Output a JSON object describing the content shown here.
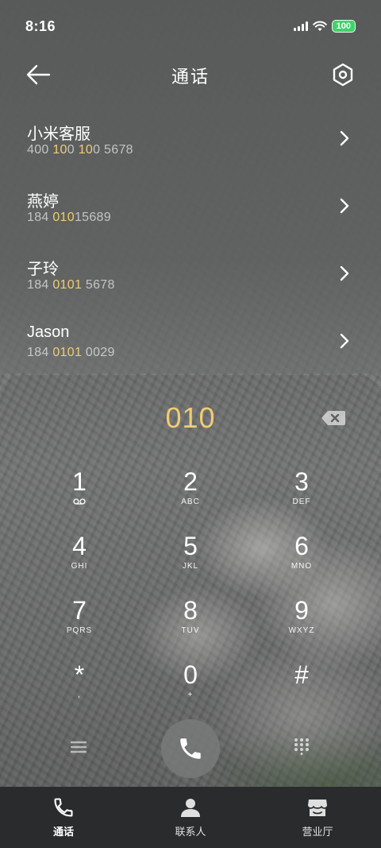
{
  "status_bar": {
    "time": "8:16",
    "battery": "100"
  },
  "header": {
    "title": "通话"
  },
  "contacts": [
    {
      "name": "小米客服",
      "num_pre": "400 ",
      "num_hl": "10",
      "num_mid": "0 ",
      "num_hl2": "10",
      "num_post": "0 5678"
    },
    {
      "name": "燕婷",
      "num_pre": "184 ",
      "num_hl": "010",
      "num_mid": "",
      "num_hl2": "",
      "num_post": "15689"
    },
    {
      "name": "子玲",
      "num_pre": "184 ",
      "num_hl": "010",
      "num_mid": "",
      "num_hl2": "1",
      "num_post": " 5678"
    },
    {
      "name": "Jason",
      "num_pre": "184 ",
      "num_hl": "010",
      "num_mid": "",
      "num_hl2": "1",
      "num_post": " 0029"
    }
  ],
  "dial_input": "010",
  "keys": [
    {
      "digit": "1",
      "letters": ""
    },
    {
      "digit": "2",
      "letters": "ABC"
    },
    {
      "digit": "3",
      "letters": "DEF"
    },
    {
      "digit": "4",
      "letters": "GHI"
    },
    {
      "digit": "5",
      "letters": "JKL"
    },
    {
      "digit": "6",
      "letters": "MNO"
    },
    {
      "digit": "7",
      "letters": "PQRS"
    },
    {
      "digit": "8",
      "letters": "TUV"
    },
    {
      "digit": "9",
      "letters": "WXYZ"
    },
    {
      "digit": "*",
      "letters": ","
    },
    {
      "digit": "0",
      "letters": "+"
    },
    {
      "digit": "#",
      "letters": ""
    }
  ],
  "nav": [
    {
      "label": "通话",
      "icon": "phone-icon"
    },
    {
      "label": "联系人",
      "icon": "person-icon"
    },
    {
      "label": "营业厅",
      "icon": "store-icon"
    }
  ],
  "colors": {
    "highlight": "#f0cc73",
    "battery": "#3fd36a",
    "nav_bg": "#2a2b2c"
  }
}
